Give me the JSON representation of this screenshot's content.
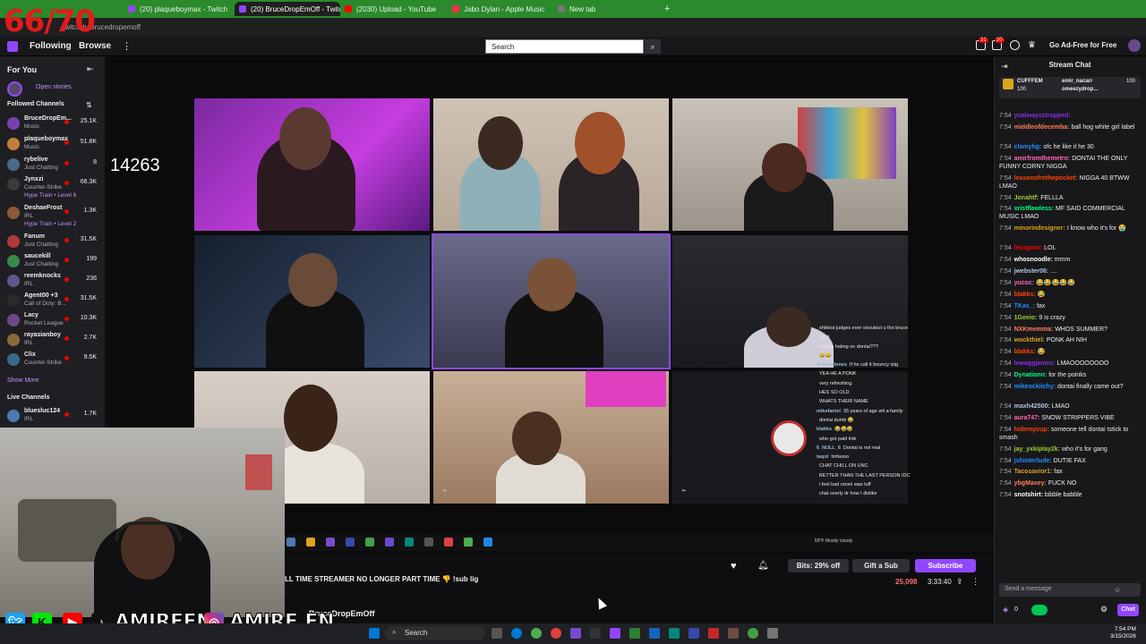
{
  "overlay": {
    "counter": "66/70",
    "viewer_number": "14263"
  },
  "browser": {
    "tabs": [
      {
        "label": "(20) plaqueboymax - Twitch",
        "color": "#9147ff"
      },
      {
        "label": "(20) BruceDropEmOff - Twitch",
        "color": "#9147ff",
        "active": true
      },
      {
        "label": "(2030) Upload - YouTube",
        "color": "#ff0000"
      },
      {
        "label": "Jabo Dylan - Apple Music",
        "color": "#fa2d48"
      },
      {
        "label": "New tab",
        "color": "#777777"
      }
    ],
    "url": "twitch.tv/brucedropemoff"
  },
  "topnav": {
    "following": "Following",
    "browse": "Browse",
    "search_placeholder": "Search",
    "ad_free": "Go Ad-Free for Free",
    "notif_badge": "31",
    "inbox_badge": "20"
  },
  "sidebar": {
    "for_you": "For You",
    "open_stories": "Open stories",
    "followed_heading": "Followed Channels",
    "channels": [
      {
        "name": "BruceDropEm...",
        "category": "Music",
        "viewers": "25.1K",
        "color": "#7b3fb0"
      },
      {
        "name": "plaqueboymax",
        "category": "Music",
        "viewers": "51.8K",
        "color": "#c08040"
      },
      {
        "name": "rybelive",
        "category": "Just Chatting",
        "viewers": "8",
        "color": "#4a6b8a"
      },
      {
        "name": "Jynxzi",
        "category": "Counter-Strike",
        "viewers": "66.3K",
        "color": "#3a3a3a",
        "hype": "Hype Train • Level 6"
      },
      {
        "name": "DeshaeFrost",
        "category": "IRL",
        "viewers": "1.3K",
        "color": "#8a5a3a",
        "hype": "Hype Train • Level 2"
      },
      {
        "name": "Fanum",
        "category": "Just Chatting",
        "viewers": "31.5K",
        "color": "#b03a3a"
      },
      {
        "name": "saucekill",
        "category": "Just Chatting",
        "viewers": "199",
        "color": "#3a8a4a"
      },
      {
        "name": "reemknocks",
        "category": "IRL",
        "viewers": "236",
        "color": "#5a5a8a"
      },
      {
        "name": "Agent00 +3",
        "category": "Call of Duty: B...",
        "viewers": "31.5K",
        "color": "#2a2a2a"
      },
      {
        "name": "Lacy",
        "category": "Rocket League",
        "viewers": "10.3K",
        "color": "#6a4a8a"
      },
      {
        "name": "rayasianboy",
        "category": "IRL",
        "viewers": "2.7K",
        "color": "#8a6a3a"
      },
      {
        "name": "Clix",
        "category": "Counter-Strike",
        "viewers": "9.5K",
        "color": "#3a6a8a"
      }
    ],
    "show_more": "Show More",
    "live_heading": "Live Channels",
    "live": [
      {
        "name": "bluesluc124",
        "category": "IRL",
        "viewers": "1.7K",
        "color": "#4a7ab0"
      }
    ]
  },
  "stream": {
    "title": "LL TIME STREAMER NO LONGER PART TIME 👎 !sub lig",
    "channel": "BruceDropEmOff",
    "bits": "Bits: 29% off",
    "gift": "Gift a Sub",
    "subscribe": "Subscribe",
    "viewers": "25,098",
    "uptime": "3:33:40",
    "inner_weather": "69°F Mostly cloudy"
  },
  "chat": {
    "heading": "Stream Chat",
    "hype_users": [
      {
        "name": "CUFFFEM",
        "amount": "100"
      },
      {
        "name": "emir_nacarr",
        "amount": "100"
      },
      {
        "name": "omeezydrop...",
        "amount": ""
      }
    ],
    "messages": [
      {
        "time": "7:54",
        "user": "yualwaysstrapped:",
        "text": "",
        "color": "#8a2be2"
      },
      {
        "time": "7:54",
        "user": "middleofdecemba:",
        "text": "ball hog white girl label",
        "color": "#ff7f50"
      },
      {
        "time": "7:54",
        "user": "clamyhg:",
        "text": "ofc he like it he 30",
        "color": "#1e90ff"
      },
      {
        "time": "7:54",
        "user": "amirfromthemetro:",
        "text": "DONTAI THE ONLY FUNNY CORNY NIGGA",
        "color": "#ff69b4"
      },
      {
        "time": "7:54",
        "user": "lessonsfrothepocket:",
        "text": "NIGGA 40 BTWW LMAO",
        "color": "#ff4500"
      },
      {
        "time": "7:54",
        "user": "Jonahtf:",
        "text": "FELLLA",
        "color": "#9acd32"
      },
      {
        "time": "7:54",
        "user": "xristflawless:",
        "text": "MF SAID COMMERCIAL MUSIC LMAO",
        "color": "#00ff7f"
      },
      {
        "time": "7:54",
        "user": "minorindesigner:",
        "text": "I know who it's for 😭",
        "color": "#daa520"
      },
      {
        "time": "7:54",
        "user": "lessgoor:",
        "text": "LOL",
        "color": "#ff0000"
      },
      {
        "time": "7:54",
        "user": "whosnoodle:",
        "text": "mmm",
        "color": "#ffffff"
      },
      {
        "time": "7:54",
        "user": "jwebster06:",
        "text": "....",
        "color": "#b0c4de"
      },
      {
        "time": "7:54",
        "user": "yucoc:",
        "text": "😂😂😂😂😂",
        "color": "#ff69b4"
      },
      {
        "time": "7:54",
        "user": "blakks:",
        "text": "😂",
        "color": "#ff4500"
      },
      {
        "time": "7:54",
        "user": "TKas_:",
        "text": "fax",
        "color": "#1e90ff"
      },
      {
        "time": "7:54",
        "user": "1Geeio:",
        "text": "9 is crazy",
        "color": "#9acd32"
      },
      {
        "time": "7:54",
        "user": "NXKmemma:",
        "text": "WHOS SUMMER?",
        "color": "#ff7f50"
      },
      {
        "time": "7:54",
        "user": "wockthiel:",
        "text": "PONK AH NIH",
        "color": "#daa520"
      },
      {
        "time": "7:54",
        "user": "blakks:",
        "text": "😂",
        "color": "#ff4500"
      },
      {
        "time": "7:54",
        "user": "lewaggjames:",
        "text": "LMAOOOOOOOO",
        "color": "#8a2be2"
      },
      {
        "time": "7:54",
        "user": "Dynationn:",
        "text": "for the poinks",
        "color": "#00ff7f"
      },
      {
        "time": "7:54",
        "user": "mikeockiichy:",
        "text": "dontai finally came out?",
        "color": "#1e90ff"
      },
      {
        "time": "7:54",
        "user": "maxh42500:",
        "text": "LMAO",
        "color": "#b0c4de"
      },
      {
        "time": "7:54",
        "user": "aura747:",
        "text": "SNOW STRIPPERS VIBE",
        "color": "#ff69b4"
      },
      {
        "time": "7:54",
        "user": "hidemycup:",
        "text": "someone tell dontai tstick to smash",
        "color": "#ff4500"
      },
      {
        "time": "7:54",
        "user": "jay_yxkiplay2k:",
        "text": "who it's for gang",
        "color": "#9acd32"
      },
      {
        "time": "7:54",
        "user": "jshinterlude:",
        "text": "DUTIE FAX",
        "color": "#1e90ff"
      },
      {
        "time": "7:54",
        "user": "Tacosavior1:",
        "text": "fax",
        "color": "#daa520"
      },
      {
        "time": "7:54",
        "user": "ybgMaxey:",
        "text": "FUCK NO",
        "color": "#ff7f50"
      },
      {
        "time": "7:54",
        "user": "snotshirt:",
        "text": "bibble babble",
        "color": "#ffffff"
      }
    ],
    "input_placeholder": "Send a message",
    "points": "0",
    "chat_button": "Chat"
  },
  "overlay_chat": [
    {
      "user": "",
      "text": "shittest judges ever shoutout u tho bruce"
    },
    {
      "user": "",
      "text": "ponk"
    },
    {
      "user": "",
      "text": "niggas hating on dontai???"
    },
    {
      "user": "",
      "text": "😂😂"
    },
    {
      "user": "AcKondones",
      "text": "If he call it bouncy istg"
    },
    {
      "user": "",
      "text": "YEA HE A PONK"
    },
    {
      "user": "",
      "text": "very refreshing"
    },
    {
      "user": "",
      "text": "HES SO OLD"
    },
    {
      "user": "",
      "text": "WHATS THEIR NAME"
    },
    {
      "user": "mikefaniel",
      "text": "35 years of age wit a family"
    },
    {
      "user": "",
      "text": "dontai dumb 😂"
    },
    {
      "user": "blakks",
      "text": "😂😂😂"
    },
    {
      "user": "",
      "text": "who got paid lmk"
    },
    {
      "user": "6_NULL_6",
      "text": "Dontai is not real"
    },
    {
      "user": "taqot",
      "text": "lmfaooo"
    },
    {
      "user": "",
      "text": "CHAT CHILL ON UNC"
    },
    {
      "user": "",
      "text": "BETTER THAN THE LAST PERSON IDC"
    },
    {
      "user": "",
      "text": "i feel bad nooni was tuff"
    },
    {
      "user": "",
      "text": "chat overly dr how I dislike"
    }
  ],
  "socials": {
    "handle_1": "AMIREFN",
    "handle_2": "AMIRE.FN"
  },
  "taskbar": {
    "search": "Search",
    "time": "7:54 PM",
    "date": "3/15/2026"
  },
  "colors": {
    "twitch_purple": "#9147ff",
    "tab_green": "#2b8a2b",
    "live_red": "#eb0400"
  }
}
